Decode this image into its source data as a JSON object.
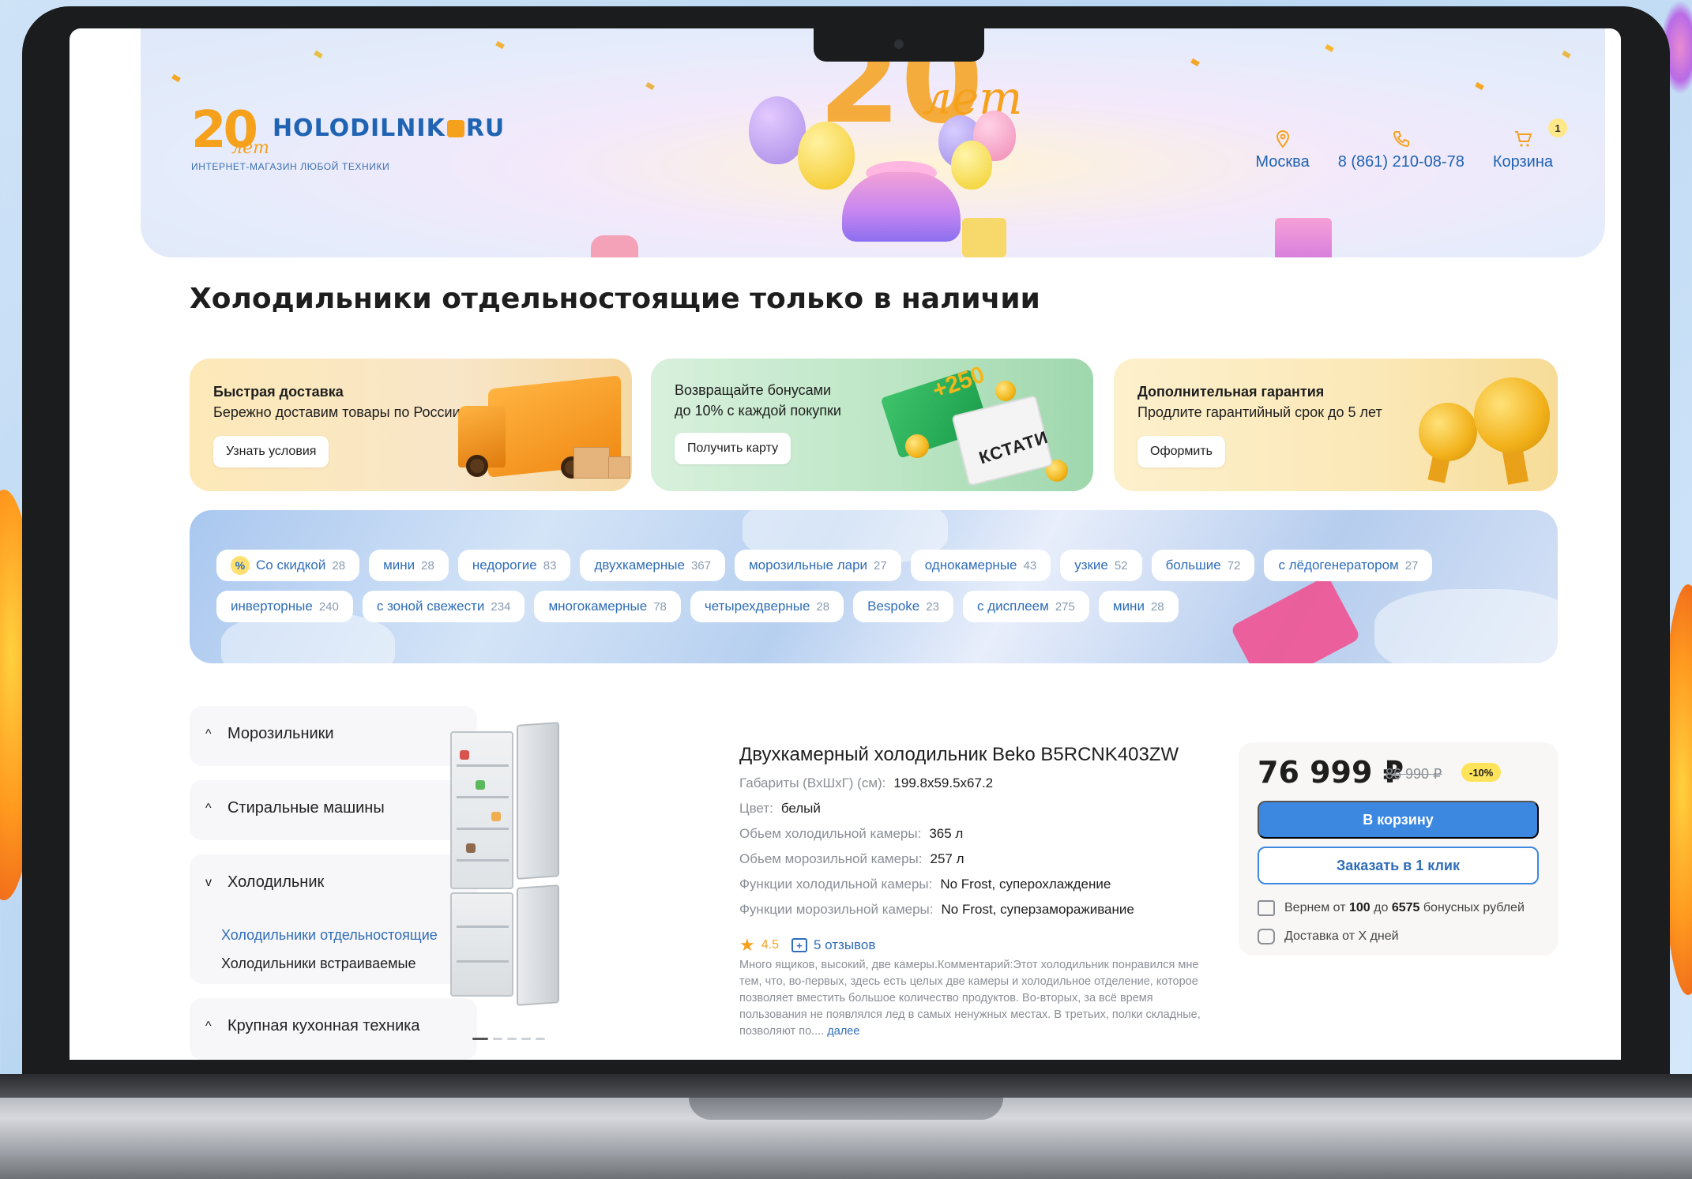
{
  "header": {
    "logo_number": "20",
    "logo_let": "лет",
    "logo_name_left": "HOLODILNIK",
    "logo_name_right": "RU",
    "logo_tagline": "ИНТЕРНЕТ-МАГАЗИН ЛЮБОЙ ТЕХНИКИ",
    "hero_number": "20",
    "hero_let": "лет",
    "city": "Москва",
    "phone": "8 (861) 210-08-78",
    "cart_label": "Корзина",
    "cart_count": "1"
  },
  "page_title": "Холодильники отдельностоящие только в наличии",
  "promos": [
    {
      "title": "Быстрая доставка",
      "subtitle": "Бережно доставим товары по России",
      "button": "Узнать условия"
    },
    {
      "title": "Возвращайте бонусами",
      "subtitle": "до 10% с каждой покупки",
      "button": "Получить карту",
      "badge": "+250",
      "package_label": "КСТАТИ"
    },
    {
      "title": "Дополнительная гарантия",
      "subtitle": "Продлите гарантийный срок до 5 лет",
      "button": "Оформить"
    }
  ],
  "filters": {
    "row1": [
      {
        "label": "Со скидкой",
        "count": "28",
        "icon": "%"
      },
      {
        "label": "мини",
        "count": "28"
      },
      {
        "label": "недорогие",
        "count": "83"
      },
      {
        "label": "двухкамерные",
        "count": "367"
      },
      {
        "label": "морозильные лари",
        "count": "27"
      },
      {
        "label": "однокамерные",
        "count": "43"
      },
      {
        "label": "узкие",
        "count": "52"
      },
      {
        "label": "большие",
        "count": "72"
      },
      {
        "label": "с лёдогенератором",
        "count": "27"
      }
    ],
    "row2": [
      {
        "label": "инверторные",
        "count": "240"
      },
      {
        "label": "с зоной свежести",
        "count": "234"
      },
      {
        "label": "многокамерные",
        "count": "78"
      },
      {
        "label": "четырехдверные",
        "count": "28"
      },
      {
        "label": "Bespoke",
        "count": "23"
      },
      {
        "label": "с дисплеем",
        "count": "275"
      },
      {
        "label": "мини",
        "count": "28"
      }
    ]
  },
  "sidebar": {
    "sections": [
      {
        "label": "Морозильники",
        "chevron": "^"
      },
      {
        "label": "Стиральные машины",
        "chevron": "^"
      },
      {
        "label": "Холодильник",
        "chevron": "v",
        "items": [
          "Холодильники отдельностоящие",
          "Холодильники встраиваемые"
        ]
      },
      {
        "label": "Крупная кухонная техника",
        "chevron": "^"
      }
    ]
  },
  "product": {
    "title": "Двухкамерный холодильник Beko B5RCNK403ZW",
    "specs": [
      {
        "label": "Габариты (ВхШхГ) (см):",
        "value": "199.8x59.5x67.2"
      },
      {
        "label": "Цвет:",
        "value": "белый"
      },
      {
        "label": "Обьем холодильной камеры:",
        "value": "365 л"
      },
      {
        "label": "Обьем морозильной камеры:",
        "value": "257 л"
      },
      {
        "label": "Функции холодильной камеры:",
        "value": "No Frost, суперохлаждение"
      },
      {
        "label": "Функции морозильной камеры:",
        "value": "No Frost, суперзамораживание"
      }
    ],
    "rating": "4.5",
    "reviews_label": "5 отзывов",
    "review_text": "Много ящиков, высокий, две камеры.Комментарий:Этот холодильник понравился мне тем, что, во-первых, здесь есть целых две камеры и холодильное отделение, которое позволяет вместить большое количество продуктов. Во-вторых, за всё время пользования не появлялся лед в самых ненужных местах. В третьих, полки складные, позволяют по....",
    "review_more": "далее",
    "image_slides": 5,
    "active_slide": 1
  },
  "buybox": {
    "price": "76 999 ₽",
    "old_price": "86 990 ₽",
    "discount": "-10%",
    "cart_button": "В корзину",
    "oneclick_button": "Заказать в 1 клик",
    "bonus_prefix": "Вернем от",
    "bonus_min": "100",
    "bonus_mid": "до",
    "bonus_max": "6575",
    "bonus_suffix": "бонусных рублей",
    "delivery": "Доставка от X дней"
  },
  "colors": {
    "brand_blue": "#1f63b3",
    "accent_orange": "#f5a11c",
    "button_blue": "#3c88e1",
    "discount_yellow": "#ffe35a"
  }
}
